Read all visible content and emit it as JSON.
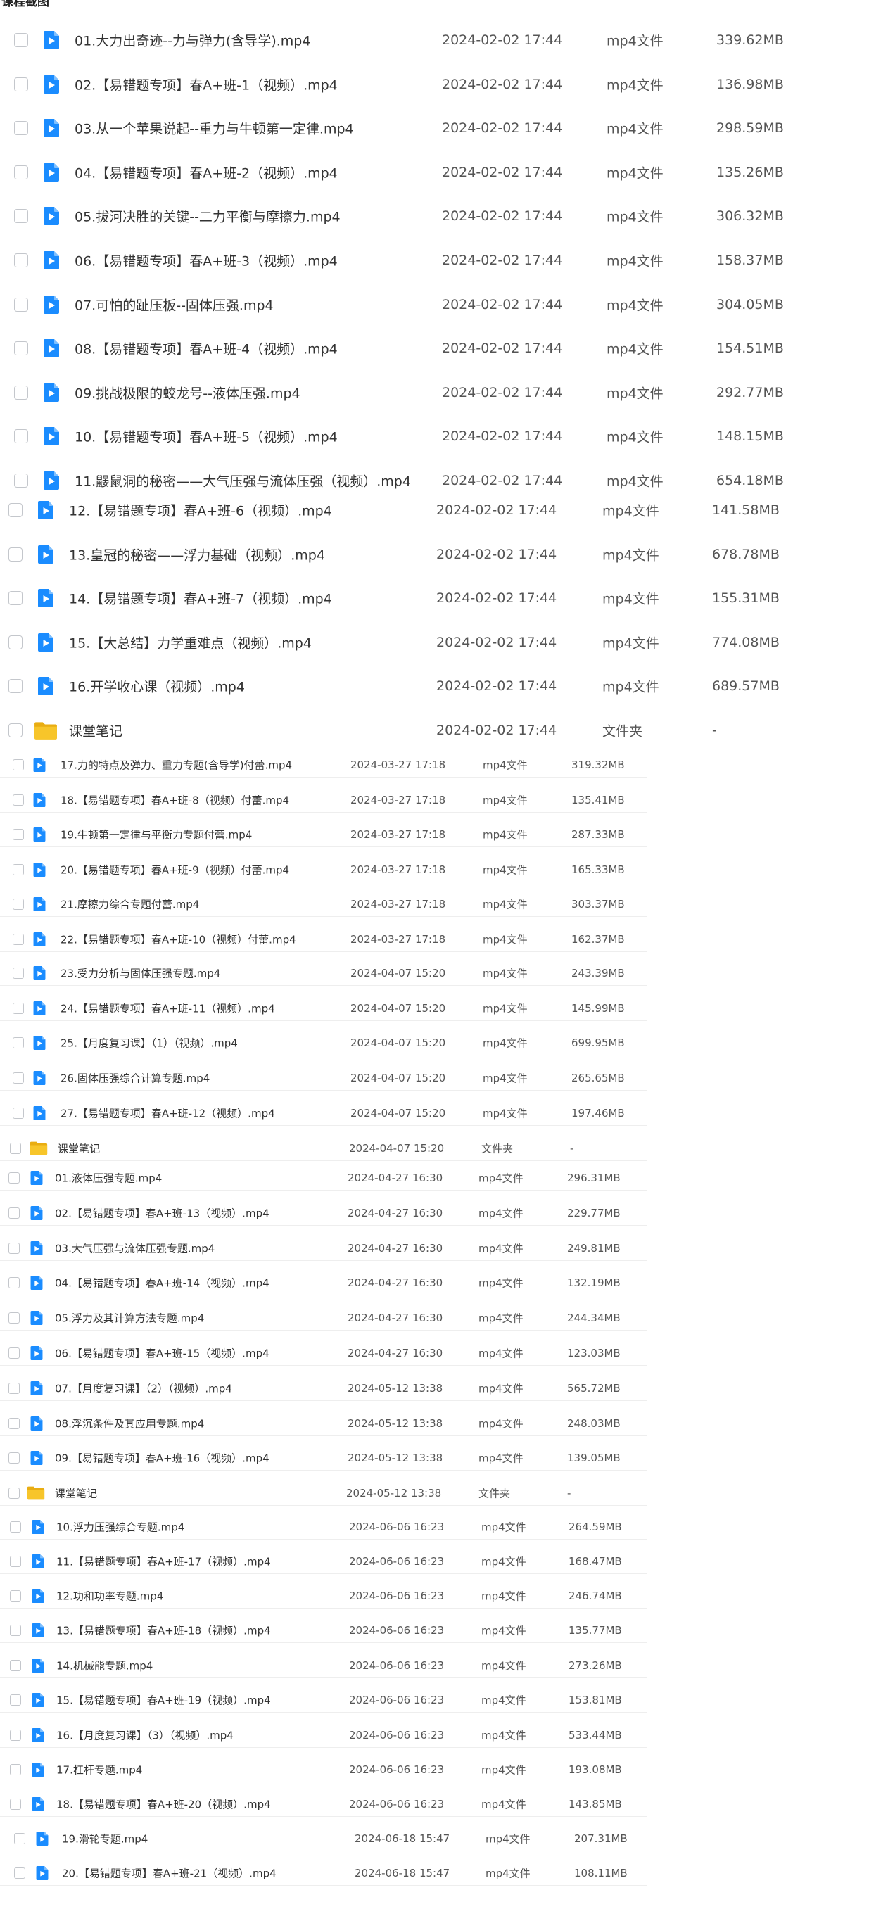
{
  "header": {
    "title": "课程截图"
  },
  "files": [
    {
      "name": "01.大力出奇迹--力与弹力(含导学).mp4",
      "date": "2024-02-02 17:44",
      "type": "mp4文件",
      "size": "339.62MB",
      "kind": "video"
    },
    {
      "name": "02.【易错题专项】春A+班-1（视频）.mp4",
      "date": "2024-02-02 17:44",
      "type": "mp4文件",
      "size": "136.98MB",
      "kind": "video"
    },
    {
      "name": "03.从一个苹果说起--重力与牛顿第一定律.mp4",
      "date": "2024-02-02 17:44",
      "type": "mp4文件",
      "size": "298.59MB",
      "kind": "video"
    },
    {
      "name": "04.【易错题专项】春A+班-2（视频）.mp4",
      "date": "2024-02-02 17:44",
      "type": "mp4文件",
      "size": "135.26MB",
      "kind": "video"
    },
    {
      "name": "05.拔河决胜的关键--二力平衡与摩擦力.mp4",
      "date": "2024-02-02 17:44",
      "type": "mp4文件",
      "size": "306.32MB",
      "kind": "video"
    },
    {
      "name": "06.【易错题专项】春A+班-3（视频）.mp4",
      "date": "2024-02-02 17:44",
      "type": "mp4文件",
      "size": "158.37MB",
      "kind": "video"
    },
    {
      "name": "07.可怕的趾压板--固体压强.mp4",
      "date": "2024-02-02 17:44",
      "type": "mp4文件",
      "size": "304.05MB",
      "kind": "video"
    },
    {
      "name": "08.【易错题专项】春A+班-4（视频）.mp4",
      "date": "2024-02-02 17:44",
      "type": "mp4文件",
      "size": "154.51MB",
      "kind": "video"
    },
    {
      "name": "09.挑战极限的蛟龙号--液体压强.mp4",
      "date": "2024-02-02 17:44",
      "type": "mp4文件",
      "size": "292.77MB",
      "kind": "video"
    },
    {
      "name": "10.【易错题专项】春A+班-5（视频）.mp4",
      "date": "2024-02-02 17:44",
      "type": "mp4文件",
      "size": "148.15MB",
      "kind": "video"
    },
    {
      "name": "11.鼹鼠洞的秘密——大气压强与流体压强（视频）.mp4",
      "date": "2024-02-02 17:44",
      "type": "mp4文件",
      "size": "654.18MB",
      "kind": "video"
    },
    {
      "name": "12.【易错题专项】春A+班-6（视频）.mp4",
      "date": "2024-02-02 17:44",
      "type": "mp4文件",
      "size": "141.58MB",
      "kind": "video"
    },
    {
      "name": "13.皇冠的秘密——浮力基础（视频）.mp4",
      "date": "2024-02-02 17:44",
      "type": "mp4文件",
      "size": "678.78MB",
      "kind": "video"
    },
    {
      "name": "14.【易错题专项】春A+班-7（视频）.mp4",
      "date": "2024-02-02 17:44",
      "type": "mp4文件",
      "size": "155.31MB",
      "kind": "video"
    },
    {
      "name": "15.【大总结】力学重难点（视频）.mp4",
      "date": "2024-02-02 17:44",
      "type": "mp4文件",
      "size": "774.08MB",
      "kind": "video"
    },
    {
      "name": "16.开学收心课（视频）.mp4",
      "date": "2024-02-02 17:44",
      "type": "mp4文件",
      "size": "689.57MB",
      "kind": "video"
    },
    {
      "name": "课堂笔记",
      "date": "2024-02-02 17:44",
      "type": "文件夹",
      "size": "-",
      "kind": "folder"
    },
    {
      "name": "17.力的特点及弹力、重力专题(含导学)付蕾.mp4",
      "date": "2024-03-27 17:18",
      "type": "mp4文件",
      "size": "319.32MB",
      "kind": "video"
    },
    {
      "name": "18.【易错题专项】春A+班-8（视频）付蕾.mp4",
      "date": "2024-03-27 17:18",
      "type": "mp4文件",
      "size": "135.41MB",
      "kind": "video"
    },
    {
      "name": "19.牛顿第一定律与平衡力专题付蕾.mp4",
      "date": "2024-03-27 17:18",
      "type": "mp4文件",
      "size": "287.33MB",
      "kind": "video"
    },
    {
      "name": "20.【易错题专项】春A+班-9（视频）付蕾.mp4",
      "date": "2024-03-27 17:18",
      "type": "mp4文件",
      "size": "165.33MB",
      "kind": "video"
    },
    {
      "name": "21.摩擦力综合专题付蕾.mp4",
      "date": "2024-03-27 17:18",
      "type": "mp4文件",
      "size": "303.37MB",
      "kind": "video"
    },
    {
      "name": "22.【易错题专项】春A+班-10（视频）付蕾.mp4",
      "date": "2024-03-27 17:18",
      "type": "mp4文件",
      "size": "162.37MB",
      "kind": "video"
    },
    {
      "name": "23.受力分析与固体压强专题.mp4",
      "date": "2024-04-07 15:20",
      "type": "mp4文件",
      "size": "243.39MB",
      "kind": "video"
    },
    {
      "name": "24.【易错题专项】春A+班-11（视频）.mp4",
      "date": "2024-04-07 15:20",
      "type": "mp4文件",
      "size": "145.99MB",
      "kind": "video"
    },
    {
      "name": "25.【月度复习课】（1）（视频）.mp4",
      "date": "2024-04-07 15:20",
      "type": "mp4文件",
      "size": "699.95MB",
      "kind": "video"
    },
    {
      "name": "26.固体压强综合计算专题.mp4",
      "date": "2024-04-07 15:20",
      "type": "mp4文件",
      "size": "265.65MB",
      "kind": "video"
    },
    {
      "name": "27.【易错题专项】春A+班-12（视频）.mp4",
      "date": "2024-04-07 15:20",
      "type": "mp4文件",
      "size": "197.46MB",
      "kind": "video"
    },
    {
      "name": "课堂笔记",
      "date": "2024-04-07 15:20",
      "type": "文件夹",
      "size": "-",
      "kind": "folder"
    },
    {
      "name": "01.液体压强专题.mp4",
      "date": "2024-04-27 16:30",
      "type": "mp4文件",
      "size": "296.31MB",
      "kind": "video"
    },
    {
      "name": "02.【易错题专项】春A+班-13（视频）.mp4",
      "date": "2024-04-27 16:30",
      "type": "mp4文件",
      "size": "229.77MB",
      "kind": "video"
    },
    {
      "name": "03.大气压强与流体压强专题.mp4",
      "date": "2024-04-27 16:30",
      "type": "mp4文件",
      "size": "249.81MB",
      "kind": "video"
    },
    {
      "name": "04.【易错题专项】春A+班-14（视频）.mp4",
      "date": "2024-04-27 16:30",
      "type": "mp4文件",
      "size": "132.19MB",
      "kind": "video"
    },
    {
      "name": "05.浮力及其计算方法专题.mp4",
      "date": "2024-04-27 16:30",
      "type": "mp4文件",
      "size": "244.34MB",
      "kind": "video"
    },
    {
      "name": "06.【易错题专项】春A+班-15（视频）.mp4",
      "date": "2024-04-27 16:30",
      "type": "mp4文件",
      "size": "123.03MB",
      "kind": "video"
    },
    {
      "name": "07.【月度复习课】（2）（视频）.mp4",
      "date": "2024-05-12 13:38",
      "type": "mp4文件",
      "size": "565.72MB",
      "kind": "video"
    },
    {
      "name": "08.浮沉条件及其应用专题.mp4",
      "date": "2024-05-12 13:38",
      "type": "mp4文件",
      "size": "248.03MB",
      "kind": "video"
    },
    {
      "name": "09.【易错题专项】春A+班-16（视频）.mp4",
      "date": "2024-05-12 13:38",
      "type": "mp4文件",
      "size": "139.05MB",
      "kind": "video"
    },
    {
      "name": "课堂笔记",
      "date": "2024-05-12 13:38",
      "type": "文件夹",
      "size": "-",
      "kind": "folder"
    },
    {
      "name": "10.浮力压强综合专题.mp4",
      "date": "2024-06-06 16:23",
      "type": "mp4文件",
      "size": "264.59MB",
      "kind": "video"
    },
    {
      "name": "11.【易错题专项】春A+班-17（视频）.mp4",
      "date": "2024-06-06 16:23",
      "type": "mp4文件",
      "size": "168.47MB",
      "kind": "video"
    },
    {
      "name": "12.功和功率专题.mp4",
      "date": "2024-06-06 16:23",
      "type": "mp4文件",
      "size": "246.74MB",
      "kind": "video"
    },
    {
      "name": "13.【易错题专项】春A+班-18（视频）.mp4",
      "date": "2024-06-06 16:23",
      "type": "mp4文件",
      "size": "135.77MB",
      "kind": "video"
    },
    {
      "name": "14.机械能专题.mp4",
      "date": "2024-06-06 16:23",
      "type": "mp4文件",
      "size": "273.26MB",
      "kind": "video"
    },
    {
      "name": "15.【易错题专项】春A+班-19（视频）.mp4",
      "date": "2024-06-06 16:23",
      "type": "mp4文件",
      "size": "153.81MB",
      "kind": "video"
    },
    {
      "name": "16.【月度复习课】（3）（视频）.mp4",
      "date": "2024-06-06 16:23",
      "type": "mp4文件",
      "size": "533.44MB",
      "kind": "video"
    },
    {
      "name": "17.杠杆专题.mp4",
      "date": "2024-06-06 16:23",
      "type": "mp4文件",
      "size": "193.08MB",
      "kind": "video"
    },
    {
      "name": "18.【易错题专项】春A+班-20（视频）.mp4",
      "date": "2024-06-06 16:23",
      "type": "mp4文件",
      "size": "143.85MB",
      "kind": "video"
    },
    {
      "name": "19.滑轮专题.mp4",
      "date": "2024-06-18 15:47",
      "type": "mp4文件",
      "size": "207.31MB",
      "kind": "video"
    },
    {
      "name": "20.【易错题专项】春A+班-21（视频）.mp4",
      "date": "2024-06-18 15:47",
      "type": "mp4文件",
      "size": "108.11MB",
      "kind": "video"
    }
  ],
  "colors": {
    "video_icon": "#1a8cff",
    "folder_icon": "#f7c52a",
    "checkbox_border": "#c4c7cc"
  },
  "icons": {
    "video": "video-file-icon",
    "folder": "folder-icon",
    "checkbox": "checkbox-icon"
  }
}
